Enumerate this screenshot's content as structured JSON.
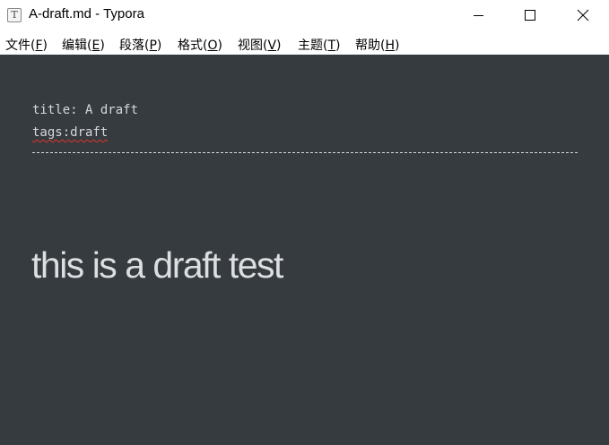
{
  "window": {
    "title": "A-draft.md - Typora",
    "app_icon_letter": "T",
    "controls": {
      "minimize": "minimize",
      "maximize": "maximize",
      "close": "close"
    }
  },
  "menu": {
    "items": [
      {
        "label": "文件(",
        "key": "F",
        "close": ")"
      },
      {
        "label": "编辑(",
        "key": "E",
        "close": ")"
      },
      {
        "label": "段落(",
        "key": "P",
        "close": ")"
      },
      {
        "label": "格式(",
        "key": "O",
        "close": ")"
      },
      {
        "label": "视图(",
        "key": "V",
        "close": ")"
      },
      {
        "label": "主题(",
        "key": "T",
        "close": ")"
      },
      {
        "label": "帮助(",
        "key": "H",
        "close": ")"
      }
    ]
  },
  "document": {
    "front_matter": {
      "line1": "title: A draft",
      "line2": "tags:draft"
    },
    "heading": "this is a draft test"
  },
  "colors": {
    "editor_bg": "#363b40",
    "text": "#d6d8da",
    "spellcheck": "#e0342a"
  }
}
